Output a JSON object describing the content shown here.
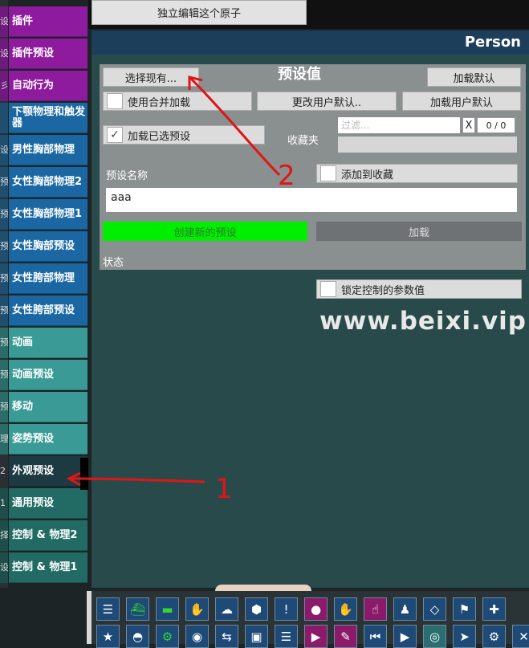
{
  "top": {
    "edit_atom_button": "独立编辑这个原子"
  },
  "panel": {
    "title": "Person",
    "choose_existing": "选择现有...",
    "preset_value_title": "预设值",
    "load_default": "加载默认",
    "use_merge_load": "使用合并加载",
    "change_user_default": "更改用户默认..",
    "load_user_default": "加载用户默认",
    "load_selected_preset": "加载已选预设",
    "load_selected_checked": true,
    "favorites_label": "收藏夹",
    "filter_placeholder": "过滤...",
    "filter_clear": "X",
    "filter_count": "0 / 0",
    "preset_name_label": "预设名称",
    "add_to_favorites": "添加到收藏",
    "preset_name_value": "aaa",
    "create_new_preset": "创建新的预设",
    "load": "加载",
    "status_label": "状态",
    "lock_params": "锁定控制的参数值"
  },
  "watermark": "www.beixi.vip",
  "annotations": {
    "one": "1",
    "two": "2"
  },
  "sidebar": {
    "items": [
      {
        "prefix": "设",
        "label": "插件"
      },
      {
        "prefix": "设",
        "label": "插件预设"
      },
      {
        "prefix": "彡",
        "label": "自动行为"
      },
      {
        "prefix": "",
        "label": "下颚物理和触发器"
      },
      {
        "prefix": "设",
        "label": "男性胸部物理"
      },
      {
        "prefix": "预",
        "label": "女性胸部物理2"
      },
      {
        "prefix": "预",
        "label": "女性胸部物理1"
      },
      {
        "prefix": "预",
        "label": "女性胸部预设"
      },
      {
        "prefix": "预",
        "label": "女性胯部物理"
      },
      {
        "prefix": "预",
        "label": "女性胯部预设"
      },
      {
        "prefix": "预",
        "label": "动画"
      },
      {
        "prefix": "预",
        "label": "动画预设"
      },
      {
        "prefix": "预",
        "label": "移动"
      },
      {
        "prefix": "理",
        "label": "姿势预设"
      },
      {
        "prefix": "2",
        "label": "外观预设"
      },
      {
        "prefix": "1",
        "label": "通用预设"
      },
      {
        "prefix": "择",
        "label": "控制 & 物理2"
      },
      {
        "prefix": "设",
        "label": "控制 & 物理1"
      }
    ]
  },
  "toolbar": {
    "row1": [
      "list-icon",
      "scene-icon",
      "folder-icon",
      "hand-red-icon",
      "cloud-icon",
      "cube-icon",
      "alert-icon",
      "person-anim-icon",
      "hand-icon",
      "touch-icon",
      "person-icon",
      "unity-icon",
      "flag-icon",
      "plus-icon"
    ],
    "row2": [
      "star-icon",
      "hat-icon",
      "folder-gear-icon",
      "camera-icon",
      "share-icon",
      "box-icon",
      "document-icon",
      "person-play-icon",
      "wrench-icon",
      "skip-back-icon",
      "play-icon",
      "target-icon",
      "cursor-icon",
      "person-gear-icon",
      "tools-icon"
    ]
  }
}
